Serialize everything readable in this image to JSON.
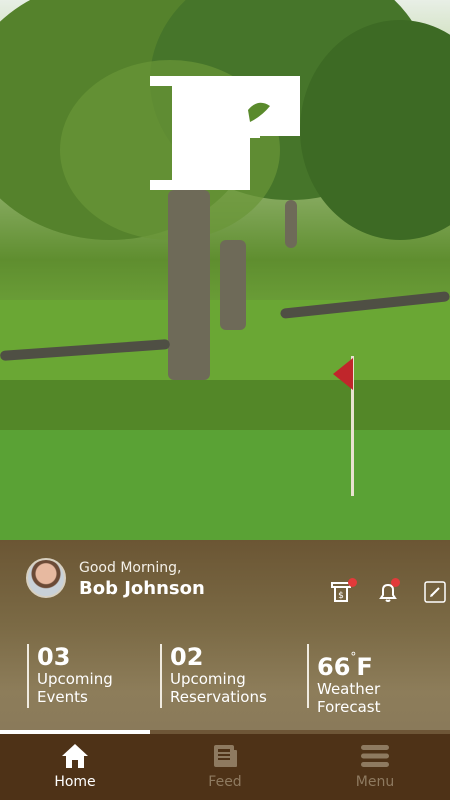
{
  "greeting": {
    "salutation": "Good Morning,",
    "name": "Bob Johnson"
  },
  "header_icons": [
    "bill-icon",
    "bell-icon",
    "edit-icon"
  ],
  "stats": [
    {
      "value": "03",
      "label_line1": "Upcoming",
      "label_line2": "Events"
    },
    {
      "value": "02",
      "label_line1": "Upcoming",
      "label_line2": "Reservations"
    },
    {
      "value": "66",
      "unit": "F",
      "label_line1": "Weather",
      "label_line2": "Forecast"
    }
  ],
  "tabs": [
    {
      "label": "Home",
      "icon": "home-icon",
      "active": true
    },
    {
      "label": "Feed",
      "icon": "feed-icon",
      "active": false
    },
    {
      "label": "Menu",
      "icon": "menu-icon",
      "active": false
    }
  ],
  "colors": {
    "accent_brown": "#4e3217",
    "notification_red": "#e23a3a",
    "flag_red": "#c0262b"
  }
}
